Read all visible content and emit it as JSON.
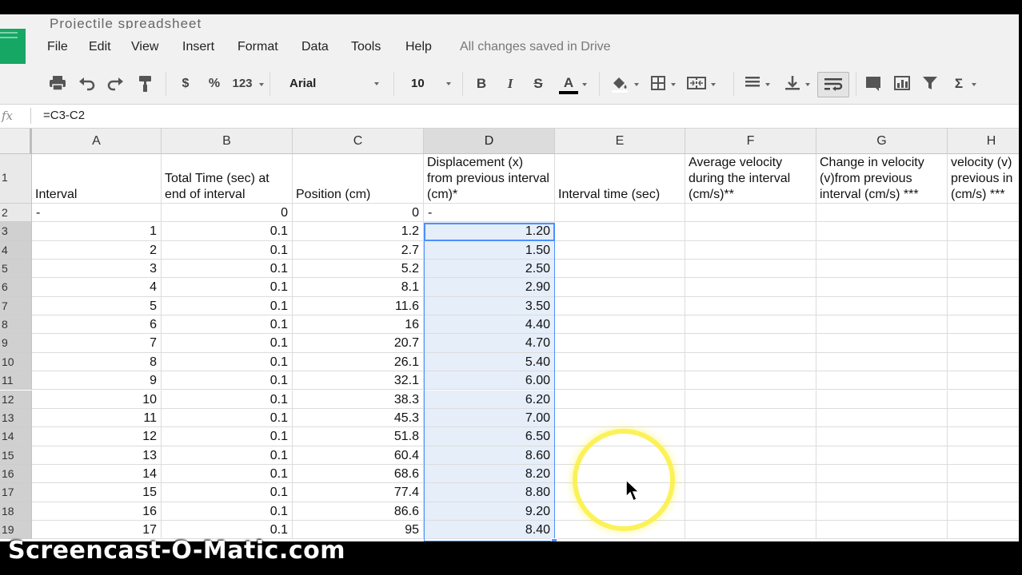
{
  "window": {
    "title_fragment": "Projectile spreadsheet"
  },
  "menu": {
    "items": [
      "File",
      "Edit",
      "View",
      "Insert",
      "Format",
      "Data",
      "Tools",
      "Help"
    ],
    "save_status": "All changes saved in Drive"
  },
  "toolbar": {
    "currency": "$",
    "percent": "%",
    "more_formats": "123",
    "font": "Arial",
    "font_size": "10",
    "bold": "B",
    "italic": "I",
    "strike": "S",
    "text_color": "A",
    "functions": "Σ"
  },
  "formula_bar": {
    "fx_label": "fx",
    "formula": "=C3-C2"
  },
  "columns": [
    "A",
    "B",
    "C",
    "D",
    "E",
    "F",
    "G",
    "H"
  ],
  "selected_column": "D",
  "header_row": {
    "A": "Interval",
    "B": "Total Time (sec) at end of interval",
    "C": "Position (cm)",
    "D": "Displacement (x) from previous interval (cm)*",
    "E": "Interval time (sec)",
    "F": "Average velocity during the interval (cm/s)**",
    "G": "Change in velocity (v)from previous interval (cm/s) ***",
    "H": "velocity (v) previous in (cm/s) ***"
  },
  "row_numbers": [
    "1",
    "2",
    "3",
    "4",
    "5",
    "6",
    "7",
    "8",
    "9",
    "10",
    "11",
    "12",
    "13",
    "14",
    "15",
    "16",
    "17",
    "18",
    "19"
  ],
  "rows": [
    {
      "a": "-",
      "b": "0",
      "c": "0",
      "d": "-"
    },
    {
      "a": "1",
      "b": "0.1",
      "c": "1.2",
      "d": "1.20"
    },
    {
      "a": "2",
      "b": "0.1",
      "c": "2.7",
      "d": "1.50"
    },
    {
      "a": "3",
      "b": "0.1",
      "c": "5.2",
      "d": "2.50"
    },
    {
      "a": "4",
      "b": "0.1",
      "c": "8.1",
      "d": "2.90"
    },
    {
      "a": "5",
      "b": "0.1",
      "c": "11.6",
      "d": "3.50"
    },
    {
      "a": "6",
      "b": "0.1",
      "c": "16",
      "d": "4.40"
    },
    {
      "a": "7",
      "b": "0.1",
      "c": "20.7",
      "d": "4.70"
    },
    {
      "a": "8",
      "b": "0.1",
      "c": "26.1",
      "d": "5.40"
    },
    {
      "a": "9",
      "b": "0.1",
      "c": "32.1",
      "d": "6.00"
    },
    {
      "a": "10",
      "b": "0.1",
      "c": "38.3",
      "d": "6.20"
    },
    {
      "a": "11",
      "b": "0.1",
      "c": "45.3",
      "d": "7.00"
    },
    {
      "a": "12",
      "b": "0.1",
      "c": "51.8",
      "d": "6.50"
    },
    {
      "a": "13",
      "b": "0.1",
      "c": "60.4",
      "d": "8.60"
    },
    {
      "a": "14",
      "b": "0.1",
      "c": "68.6",
      "d": "8.20"
    },
    {
      "a": "15",
      "b": "0.1",
      "c": "77.4",
      "d": "8.80"
    },
    {
      "a": "16",
      "b": "0.1",
      "c": "86.6",
      "d": "9.20"
    },
    {
      "a": "17",
      "b": "0.1",
      "c": "95",
      "d": "8.40"
    }
  ],
  "watermark": "Screencast-O-Matic.com",
  "colors": {
    "selection": "#4d90fe",
    "selection_fill": "#e6eef9",
    "sheets_green": "#16a765",
    "highlight": "#faf03c"
  }
}
